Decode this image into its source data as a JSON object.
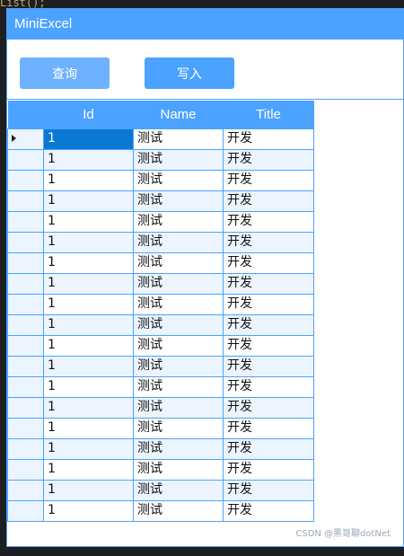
{
  "window": {
    "title": "MiniExcel"
  },
  "toolbar": {
    "query_label": "查询",
    "write_label": "写入"
  },
  "grid": {
    "columns": [
      "Id",
      "Name",
      "Title"
    ],
    "selected_row": 0,
    "rows": [
      [
        "1",
        "测试",
        "开发"
      ],
      [
        "1",
        "测试",
        "开发"
      ],
      [
        "1",
        "测试",
        "开发"
      ],
      [
        "1",
        "测试",
        "开发"
      ],
      [
        "1",
        "测试",
        "开发"
      ],
      [
        "1",
        "测试",
        "开发"
      ],
      [
        "1",
        "测试",
        "开发"
      ],
      [
        "1",
        "测试",
        "开发"
      ],
      [
        "1",
        "测试",
        "开发"
      ],
      [
        "1",
        "测试",
        "开发"
      ],
      [
        "1",
        "测试",
        "开发"
      ],
      [
        "1",
        "测试",
        "开发"
      ],
      [
        "1",
        "测试",
        "开发"
      ],
      [
        "1",
        "测试",
        "开发"
      ],
      [
        "1",
        "测试",
        "开发"
      ],
      [
        "1",
        "测试",
        "开发"
      ],
      [
        "1",
        "测试",
        "开发"
      ],
      [
        "1",
        "测试",
        "开发"
      ],
      [
        "1",
        "测试",
        "开发"
      ]
    ]
  },
  "watermark": "CSDN @黑哥聊dotNet",
  "colors": {
    "accent": "#4ba3ff",
    "selection": "#0b78d4",
    "alt_row": "#ecf4ff"
  }
}
